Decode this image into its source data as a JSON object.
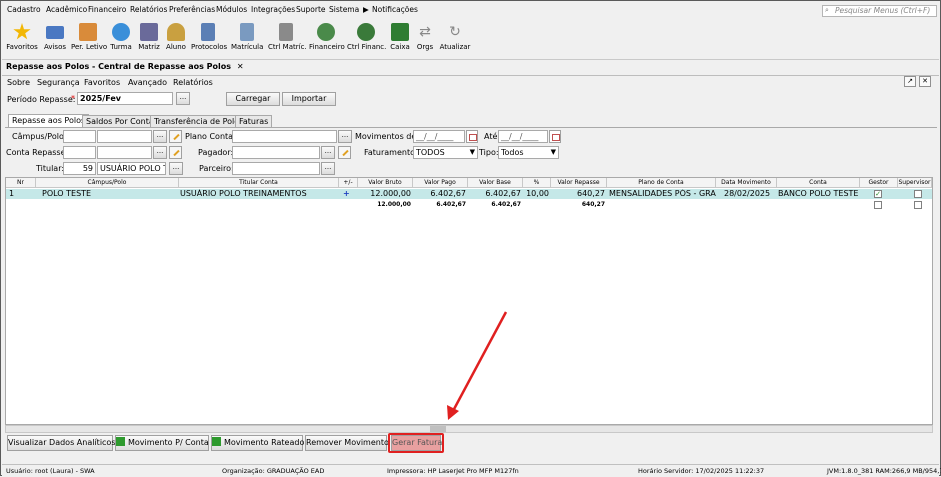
{
  "menu": [
    "Cadastro",
    "Acadêmico",
    "Financeiro",
    "Relatórios",
    "Preferências",
    "Módulos",
    "Integrações",
    "Suporte",
    "Sistema",
    "Notificações"
  ],
  "search_placeholder": "Pesquisar Menus (Ctrl+F)",
  "toolbar": [
    {
      "label": "Favoritos",
      "icon": "star-icon",
      "color": "#f2b705"
    },
    {
      "label": "Avisos",
      "icon": "envelope-icon",
      "color": "#4a78c2"
    },
    {
      "label": "Per. Letivo",
      "icon": "calendar-icon",
      "color": "#d98b3a"
    },
    {
      "label": "Turma",
      "icon": "group-icon",
      "color": "#3a8fd9"
    },
    {
      "label": "Matriz",
      "icon": "matrix-icon",
      "color": "#6a6a9a"
    },
    {
      "label": "Aluno",
      "icon": "student-icon",
      "color": "#c9a040"
    },
    {
      "label": "Protocolos",
      "icon": "protocol-icon",
      "color": "#5b7fb5"
    },
    {
      "label": "Matrícula",
      "icon": "enrollment-icon",
      "color": "#7a9ac0"
    },
    {
      "label": "Ctrl Matríc.",
      "icon": "enrollment-control-icon",
      "color": "#8a8a8a"
    },
    {
      "label": "Financeiro",
      "icon": "finance-icon",
      "color": "#4a8a4a"
    },
    {
      "label": "Ctrl Financ.",
      "icon": "finance-control-icon",
      "color": "#3a7a3a"
    },
    {
      "label": "Caixa",
      "icon": "cashier-icon",
      "color": "#2e7d32"
    },
    {
      "label": "Orgs",
      "icon": "swap-icon",
      "color": "#888888"
    },
    {
      "label": "Atualizar",
      "icon": "refresh-icon",
      "color": "#888888"
    }
  ],
  "tab_title": "Repasse aos Polos - Central de Repasse aos Polos",
  "submenu": [
    "Sobre",
    "Segurança",
    "Favoritos",
    "Avançado",
    "Relatórios"
  ],
  "periodo": {
    "label": "Período Repasse:",
    "required": "*",
    "value": "2025/Fev",
    "browse": "...",
    "carregar": "Carregar",
    "importar": "Importar"
  },
  "tabs": [
    "Repasse aos Polos",
    "Saldos Por Conta",
    "Transferência de Polo",
    "Faturas"
  ],
  "filters": {
    "campus_label": "Câmpus/Polo:",
    "plano_label": "Plano Conta:",
    "movimentos_label": "Movimentos de:",
    "movimentos_from": "__/__/____",
    "ate_label": "Até:",
    "ate_value": "__/__/____",
    "conta_label": "Conta Repasse:",
    "pagador_label": "Pagador:",
    "faturamento_label": "Faturamento:",
    "faturamento_value": "TODOS",
    "tipo_label": "Tipo:",
    "tipo_value": "Todos",
    "titular_label": "Titular:",
    "titular_code": "59",
    "titular_name": "USUÁRIO POLO TR",
    "parceiro_label": "Parceiro:",
    "dots": "..."
  },
  "table": {
    "headers": [
      "Nr",
      "Câmpus/Polo",
      "Titular Conta",
      "+/-",
      "Valor Bruto",
      "Valor Pago",
      "Valor Base",
      "%",
      "Valor Repasse",
      "Plano de Conta",
      "Data Movimento",
      "Conta",
      "Gestor",
      "Supervisor"
    ],
    "rows": [
      {
        "nr": "1",
        "campus": "POLO TESTE",
        "titular": "USUÁRIO POLO TREINAMENTOS",
        "sign": "+",
        "bruto": "12.000,00",
        "pago": "6.402,67",
        "base": "6.402,67",
        "pct": "10,00",
        "repasse": "640,27",
        "plano": "MENSALIDADES PÓS - GRA...",
        "data": "28/02/2025",
        "conta": "BANCO POLO TESTE",
        "gestor": true,
        "supervisor": false
      }
    ],
    "totals": {
      "bruto": "12.000,00",
      "pago": "6.402,67",
      "base": "6.402,67",
      "repasse": "640,27"
    }
  },
  "buttons": [
    "Visualizar Dados Analíticos",
    "Movimento P/ Conta",
    "Movimento Rateado",
    "Remover Movimento",
    "Gerar Fatura"
  ],
  "status": {
    "user": "Usuário: root (Laura) - SWA",
    "org": "Organização: GRADUAÇÃO EAD",
    "printer": "Impressora: HP LaserJet Pro MFP M127fn",
    "server_time": "Horário Servidor: 17/02/2025 11:22:37",
    "jvm": "JVM:1.8.0_381  RAM:266,9 MB/954,7 MB"
  }
}
